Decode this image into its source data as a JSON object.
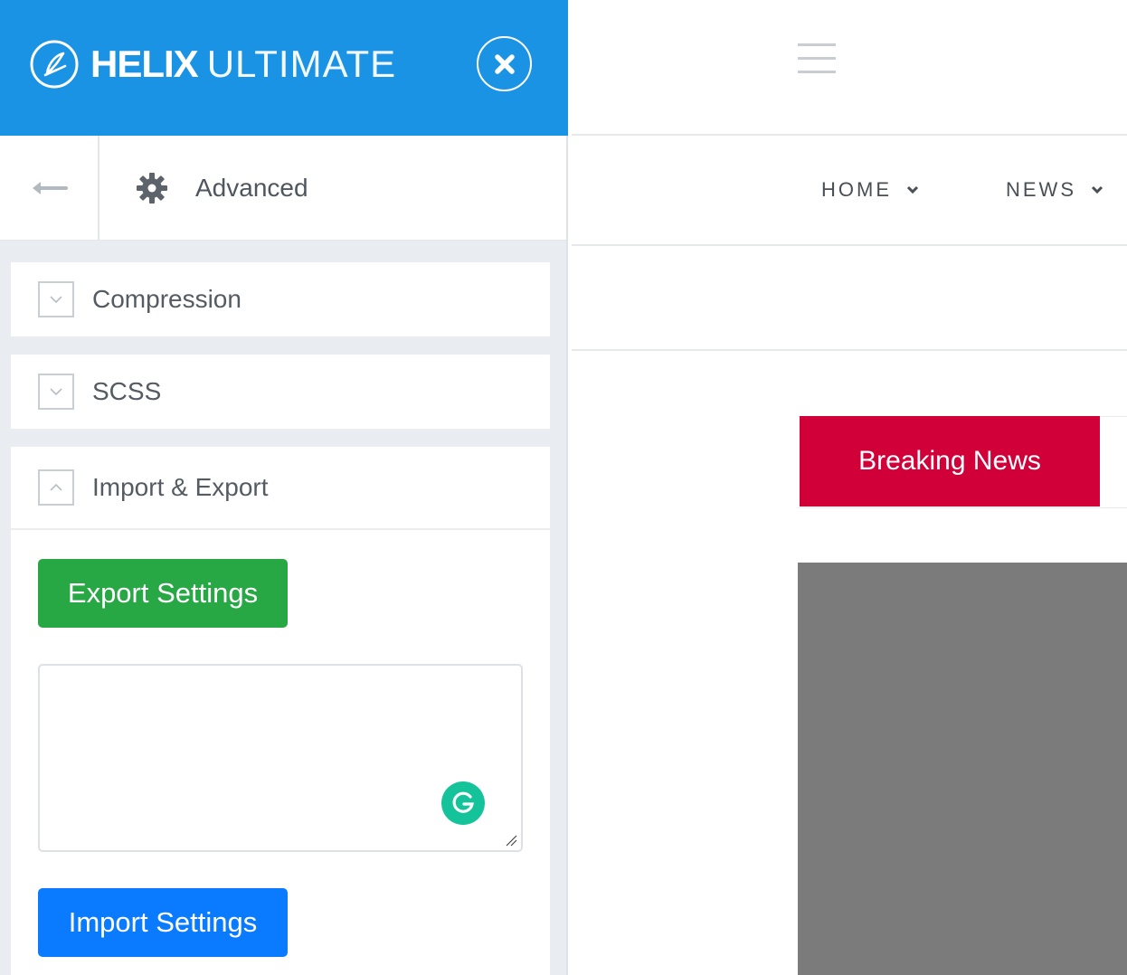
{
  "sidebar": {
    "brand": {
      "bold": "HELIX",
      "light": "ULTIMATE"
    },
    "section_title": "Advanced",
    "panels": [
      {
        "label": "Compression",
        "expanded": false
      },
      {
        "label": "SCSS",
        "expanded": false
      },
      {
        "label": "Import & Export",
        "expanded": true
      }
    ],
    "import_export": {
      "export_label": "Export Settings",
      "import_label": "Import Settings",
      "textarea_value": ""
    }
  },
  "preview": {
    "nav": [
      {
        "label": "HOME"
      },
      {
        "label": "NEWS"
      }
    ],
    "breaking_news_label": "Breaking News"
  },
  "colors": {
    "header_blue": "#1a93e5",
    "export_green": "#28a745",
    "import_blue": "#0a7bff",
    "breaking_red": "#d20038",
    "grammarly_green": "#15c39a"
  }
}
